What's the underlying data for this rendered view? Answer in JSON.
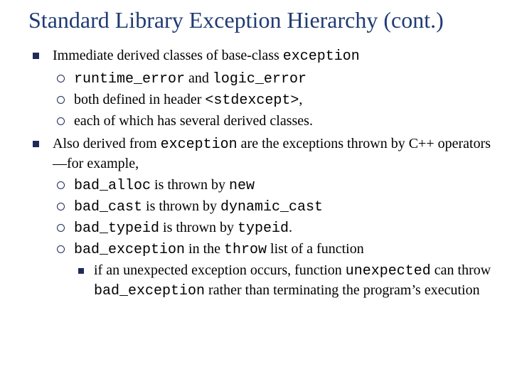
{
  "title": "Standard Library Exception Hierarchy (cont.)",
  "b1": {
    "lead_a": "Immediate derived classes of base-class ",
    "lead_code": "exception",
    "i1": {
      "c1": "runtime_error",
      "mid": " and ",
      "c2": "logic_error"
    },
    "i2": {
      "a": "both defined in header ",
      "c": "<stdexcept>",
      "b": ","
    },
    "i3": "each of which has several derived classes."
  },
  "b2": {
    "a": "Also derived from ",
    "c": "exception",
    "b": " are the exceptions thrown by C++ operators—for example,",
    "i1": {
      "c": "bad_alloc",
      "mid": " is thrown by ",
      "c2": "new"
    },
    "i2": {
      "c": "bad_cast",
      "mid": " is thrown by ",
      "c2": "dynamic_cast"
    },
    "i3": {
      "c": "bad_typeid",
      "mid": " is thrown by ",
      "c2": "typeid",
      "tail": "."
    },
    "i4": {
      "c": "bad_exception",
      "mid": " in the ",
      "c2": "throw",
      "tail": " list of a function",
      "sub": {
        "a": "if an unexpected exception occurs, function ",
        "c1": "unexpected",
        "b": " can throw ",
        "c2": "bad_exception",
        "d": " rather than terminating the program’s execution"
      }
    }
  }
}
